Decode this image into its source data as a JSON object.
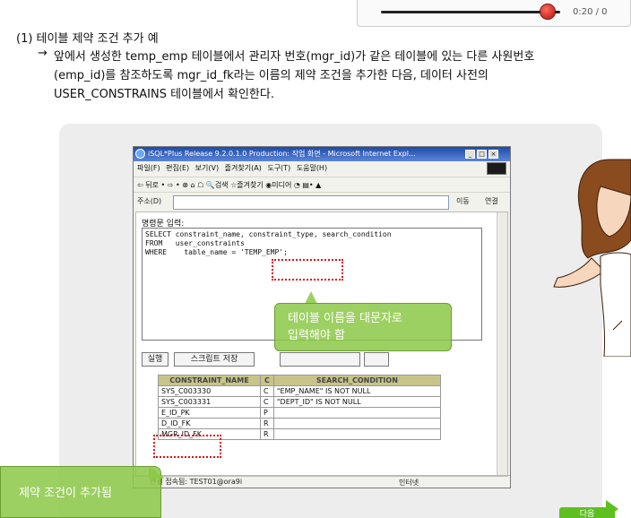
{
  "player": {
    "time": "0:20 / 0"
  },
  "section": {
    "title": "(1) 테이블 제약 조건 추가 예",
    "arrow": "→",
    "line1": "앞에서 생성한 temp_emp 테이블에서 관리자 번호(mgr_id)가 같은 테이블에 있는 다른 사원번호",
    "line2": "(emp_id)를 참조하도록 mgr_id_fk라는 이름의 제약 조건을 추가한 다음, 데이터 사전의",
    "line3": "USER_CONSTRAINS 테이블에서 확인한다."
  },
  "browser": {
    "title": "iSQL*Plus Release 9.2.0.1.0 Production: 작업 화면 - Microsoft Internet Expl...",
    "menu": "파일(F) 편집(E) 보기(V) 즐겨찾기(A) 도구(T) 도움말(H)",
    "toolbar": "⇦ 뒤로 • ⇨ • ⊗ ⌂ ☖ 🔍검색 ☆즐겨찾기 ◉미디어 ◔ ▤• ▲",
    "address_label": "주소(D)",
    "go": "이동",
    "links": "연결",
    "textarea_label": "명령문 입력:",
    "sql": "SELECT constraint_name, constraint_type, search_condition\nFROM   user_constraints\nWHERE    table_name = 'TEMP_EMP';",
    "execute": "실행",
    "save_script": "스크립트 저장",
    "table_headers": [
      "CONSTRAINT_NAME",
      "C",
      "SEARCH_CONDITION"
    ],
    "table_rows": [
      [
        "SYS_C003330",
        "C",
        "\"EMP_NAME\" IS NOT NULL"
      ],
      [
        "SYS_C003331",
        "C",
        "\"DEPT_ID\" IS NOT NULL"
      ],
      [
        "E_ID_PK",
        "P",
        ""
      ],
      [
        "D_ID_FK",
        "R",
        ""
      ],
      [
        "MGR_ID_FK",
        "R",
        ""
      ]
    ],
    "status": "연결 접속됨: TEST01@ora9i",
    "zone": "인터넷"
  },
  "callouts": {
    "uppercase": "테이블 이름을 대문자로\n입력해야 함",
    "added": "제약 조건이 추가됨"
  },
  "next_label": "다음"
}
